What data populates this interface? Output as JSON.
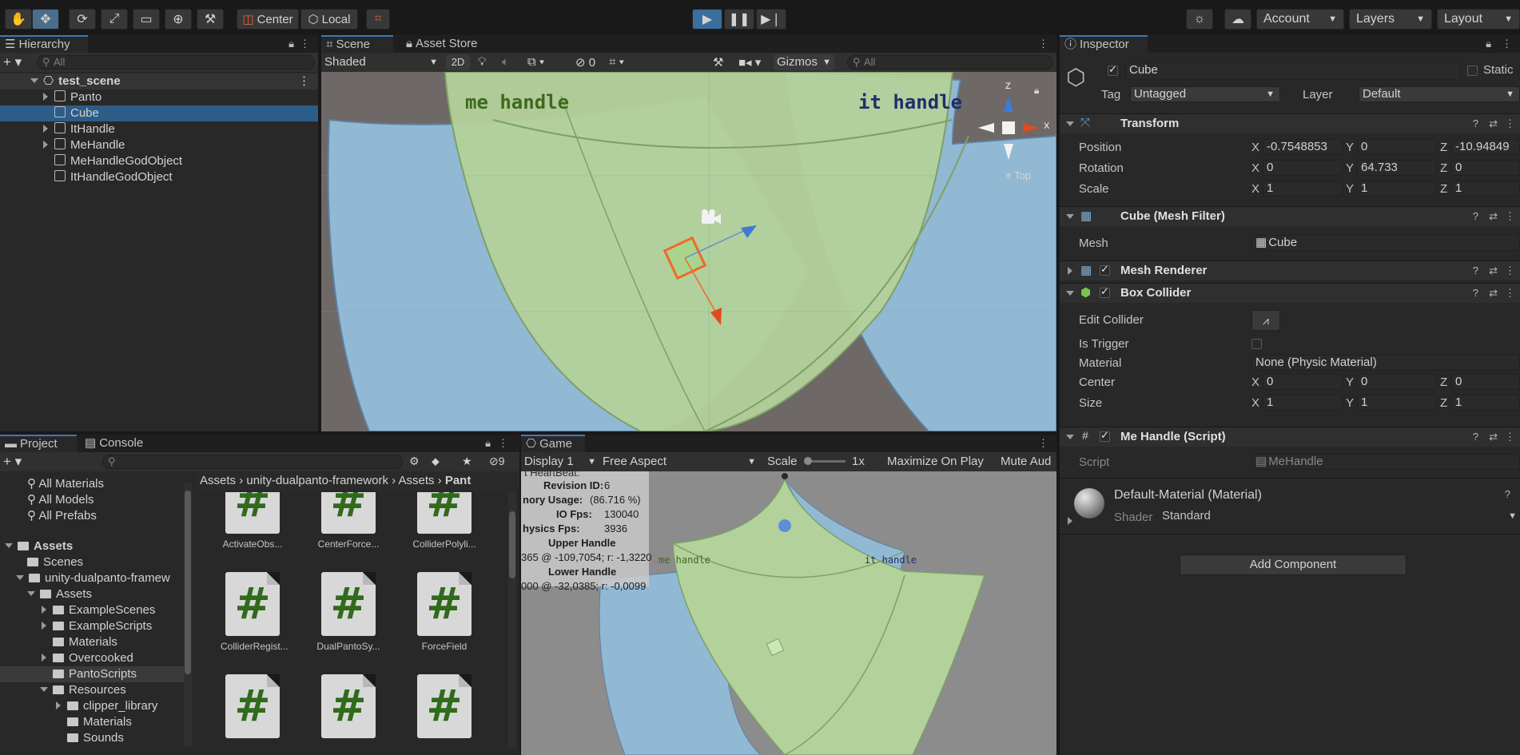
{
  "toolbar": {
    "center_label": "Center",
    "local_label": "Local",
    "account_label": "Account",
    "layers_label": "Layers",
    "layout_label": "Layout"
  },
  "hierarchy": {
    "tab_label": "Hierarchy",
    "search_placeholder": "All",
    "scene_name": "test_scene",
    "items": [
      {
        "label": "Panto",
        "expandable": true
      },
      {
        "label": "Cube",
        "expandable": false,
        "selected": true
      },
      {
        "label": "ItHandle",
        "expandable": true
      },
      {
        "label": "MeHandle",
        "expandable": true
      },
      {
        "label": "MeHandleGodObject",
        "expandable": false
      },
      {
        "label": "ItHandleGodObject",
        "expandable": false
      }
    ]
  },
  "scene": {
    "tab_scene": "Scene",
    "tab_asset_store": "Asset Store",
    "shading": "Shaded",
    "mode_2d": "2D",
    "hidden_count": "0",
    "gizmos": "Gizmos",
    "search_placeholder": "All",
    "label_me": "me handle",
    "label_it": "it handle",
    "gizmo_z": "Z",
    "gizmo_x": "X",
    "view_label": "Top"
  },
  "inspector": {
    "tab_label": "Inspector",
    "object_name": "Cube",
    "static_label": "Static",
    "tag_label": "Tag",
    "tag_value": "Untagged",
    "layer_label": "Layer",
    "layer_value": "Default",
    "transform": {
      "title": "Transform",
      "position_label": "Position",
      "rotation_label": "Rotation",
      "scale_label": "Scale",
      "position": {
        "x": "-0.7548853",
        "y": "0",
        "z": "-10.94849"
      },
      "rotation": {
        "x": "0",
        "y": "64.733",
        "z": "0"
      },
      "scale": {
        "x": "1",
        "y": "1",
        "z": "1"
      }
    },
    "mesh_filter": {
      "title": "Cube (Mesh Filter)",
      "mesh_label": "Mesh",
      "mesh_value": "Cube"
    },
    "mesh_renderer": {
      "title": "Mesh Renderer"
    },
    "box_collider": {
      "title": "Box Collider",
      "edit_label": "Edit Collider",
      "trigger_label": "Is Trigger",
      "material_label": "Material",
      "material_value": "None (Physic Material)",
      "center_label": "Center",
      "center": {
        "x": "0",
        "y": "0",
        "z": "0"
      },
      "size_label": "Size",
      "size": {
        "x": "1",
        "y": "1",
        "z": "1"
      }
    },
    "script_comp": {
      "title": "Me Handle (Script)",
      "script_label": "Script",
      "script_value": "MeHandle"
    },
    "material": {
      "title": "Default-Material (Material)",
      "shader_label": "Shader",
      "shader_value": "Standard"
    },
    "add_component": "Add Component",
    "axis_x": "X",
    "axis_y": "Y",
    "axis_z": "Z"
  },
  "project": {
    "tab_project": "Project",
    "tab_console": "Console",
    "hidden_count": "9",
    "favorites": [
      "All Materials",
      "All Models",
      "All Prefabs"
    ],
    "tree": [
      {
        "label": "Assets",
        "level": 0,
        "bold": true
      },
      {
        "label": "Scenes",
        "level": 1
      },
      {
        "label": "unity-dualpanto-framew",
        "level": 1
      },
      {
        "label": "Assets",
        "level": 2
      },
      {
        "label": "ExampleScenes",
        "level": 3
      },
      {
        "label": "ExampleScripts",
        "level": 3
      },
      {
        "label": "Materials",
        "level": 3
      },
      {
        "label": "Overcooked",
        "level": 3
      },
      {
        "label": "PantoScripts",
        "level": 3
      },
      {
        "label": "Resources",
        "level": 3
      },
      {
        "label": "clipper_library",
        "level": 4
      },
      {
        "label": "Materials",
        "level": 4
      },
      {
        "label": "Sounds",
        "level": 4
      }
    ],
    "breadcrumb": [
      "Assets",
      "unity-dualpanto-framework",
      "Assets",
      "Pant"
    ],
    "assets": [
      "ActivateObs...",
      "CenterForce...",
      "ColliderPolyli...",
      "ColliderRegist...",
      "DualPantoSy...",
      "ForceField",
      "",
      "",
      ""
    ]
  },
  "game": {
    "tab_label": "Game",
    "display": "Display 1",
    "aspect": "Free Aspect",
    "scale_label": "Scale",
    "scale_value": "1x",
    "maximize": "Maximize On Play",
    "mute": "Mute Aud",
    "stats": {
      "heartbeat": "t HeartBeat:",
      "revision_label": "Revision ID:",
      "revision_value": "6",
      "memory_label": "nory Usage:",
      "memory_value": "(86.716 %)",
      "io_label": "IO Fps:",
      "io_value": "130040",
      "physics_label": "hysics Fps:",
      "physics_value": "3936",
      "upper_title": "Upper Handle",
      "upper_value": "365 @ -109,7054; r: -1,3220",
      "lower_title": "Lower Handle",
      "lower_value": "000 @ -32,0385; r: -0,0099"
    },
    "label_me": "me handle",
    "label_it": "it handle"
  }
}
